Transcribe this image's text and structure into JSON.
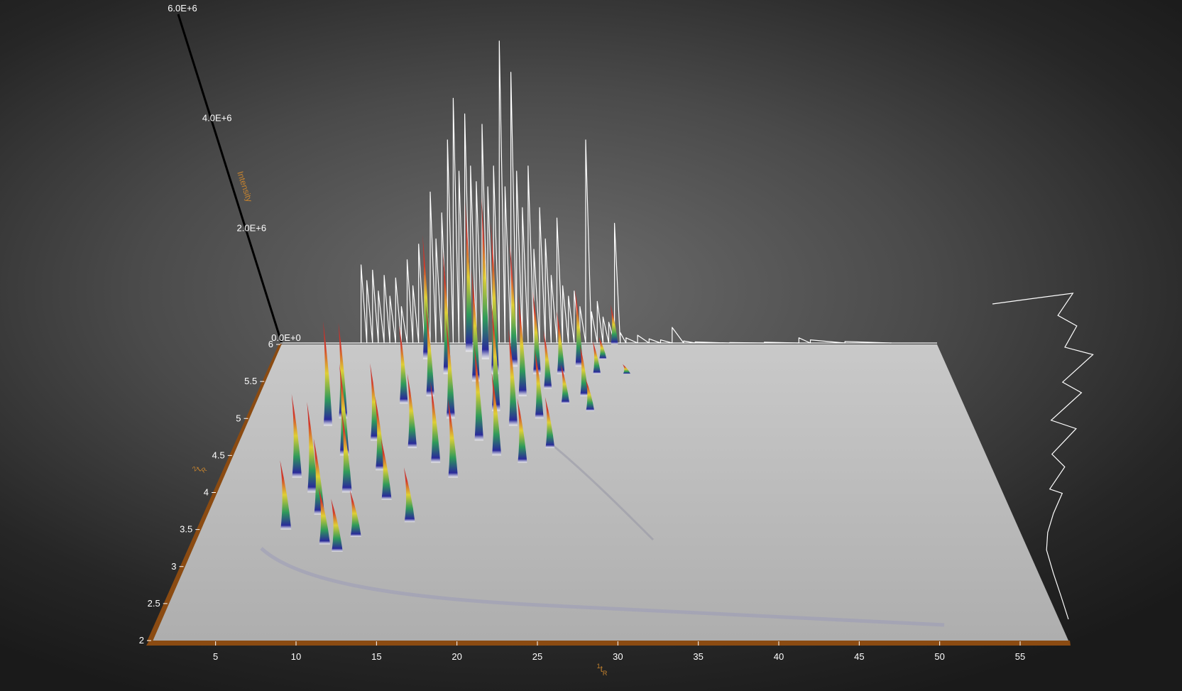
{
  "colors": {
    "floor": "#bdbdbd",
    "axis_bar": "#8b4b12",
    "axis_title": "#c8842e",
    "tick_text": "#ffffff",
    "profile_line": "#ffffff",
    "colormap": [
      "#2a2a9a",
      "#2e9a5a",
      "#dfcf35",
      "#d23a2a"
    ]
  },
  "chart_data": {
    "type": "surface",
    "x_axis": {
      "title": "1tR",
      "title_base": "t",
      "title_sup": "1",
      "title_sub": "R",
      "ticks": [
        "5",
        "10",
        "15",
        "20",
        "25",
        "30",
        "35",
        "40",
        "45",
        "50",
        "55"
      ],
      "range": [
        1,
        58
      ]
    },
    "y_axis": {
      "title": "2tR",
      "title_base": "t",
      "title_sup": "2",
      "title_sub": "R",
      "ticks": [
        "2",
        "2.5",
        "3",
        "3.5",
        "4",
        "4.5",
        "5",
        "5.5",
        "6"
      ],
      "range": [
        2,
        6
      ]
    },
    "z_axis": {
      "title": "Intensity",
      "ticks": [
        "0.0E+0",
        "2.0E+6",
        "4.0E+6",
        "6.0E+6"
      ],
      "range": [
        0,
        6000000
      ]
    },
    "peaks": [
      {
        "x": 6.5,
        "y": 4.2,
        "z": 2000000
      },
      {
        "x": 7.0,
        "y": 3.5,
        "z": 1500000
      },
      {
        "x": 7.5,
        "y": 4.9,
        "z": 2800000
      },
      {
        "x": 8.0,
        "y": 4.0,
        "z": 2100000
      },
      {
        "x": 8.5,
        "y": 5.0,
        "z": 2600000
      },
      {
        "x": 9.0,
        "y": 3.7,
        "z": 1700000
      },
      {
        "x": 9.5,
        "y": 4.5,
        "z": 2300000
      },
      {
        "x": 10.0,
        "y": 3.3,
        "z": 1200000
      },
      {
        "x": 10.5,
        "y": 4.0,
        "z": 1900000
      },
      {
        "x": 11.0,
        "y": 3.2,
        "z": 1100000
      },
      {
        "x": 11.5,
        "y": 4.7,
        "z": 2000000
      },
      {
        "x": 12.0,
        "y": 3.4,
        "z": 1000000
      },
      {
        "x": 12.5,
        "y": 4.3,
        "z": 1800000
      },
      {
        "x": 13.0,
        "y": 5.2,
        "z": 2200000
      },
      {
        "x": 13.5,
        "y": 3.9,
        "z": 1400000
      },
      {
        "x": 14.0,
        "y": 5.8,
        "z": 3900000
      },
      {
        "x": 14.5,
        "y": 4.6,
        "z": 1900000
      },
      {
        "x": 15.0,
        "y": 5.3,
        "z": 2600000
      },
      {
        "x": 15.5,
        "y": 3.6,
        "z": 1200000
      },
      {
        "x": 16.0,
        "y": 5.6,
        "z": 3700000
      },
      {
        "x": 16.5,
        "y": 4.4,
        "z": 2000000
      },
      {
        "x": 17.0,
        "y": 5.0,
        "z": 2700000
      },
      {
        "x": 17.5,
        "y": 5.9,
        "z": 4800000
      },
      {
        "x": 18.0,
        "y": 4.2,
        "z": 1900000
      },
      {
        "x": 18.5,
        "y": 5.5,
        "z": 3300000
      },
      {
        "x": 19.0,
        "y": 5.8,
        "z": 5100000
      },
      {
        "x": 19.5,
        "y": 4.7,
        "z": 2500000
      },
      {
        "x": 20.0,
        "y": 5.6,
        "z": 4600000
      },
      {
        "x": 20.5,
        "y": 5.1,
        "z": 3000000
      },
      {
        "x": 21.0,
        "y": 4.5,
        "z": 2100000
      },
      {
        "x": 21.5,
        "y": 5.7,
        "z": 3800000
      },
      {
        "x": 22.0,
        "y": 4.9,
        "z": 2600000
      },
      {
        "x": 22.5,
        "y": 5.3,
        "z": 2900000
      },
      {
        "x": 23.0,
        "y": 4.4,
        "z": 1600000
      },
      {
        "x": 23.5,
        "y": 5.6,
        "z": 2500000
      },
      {
        "x": 24.0,
        "y": 5.0,
        "z": 1900000
      },
      {
        "x": 24.5,
        "y": 5.4,
        "z": 1700000
      },
      {
        "x": 25.0,
        "y": 4.6,
        "z": 1300000
      },
      {
        "x": 25.5,
        "y": 5.6,
        "z": 1900000
      },
      {
        "x": 26.0,
        "y": 5.2,
        "z": 1100000
      },
      {
        "x": 27.0,
        "y": 5.7,
        "z": 2400000
      },
      {
        "x": 27.5,
        "y": 5.3,
        "z": 1500000
      },
      {
        "x": 28.0,
        "y": 5.1,
        "z": 900000
      },
      {
        "x": 28.5,
        "y": 5.6,
        "z": 1000000
      },
      {
        "x": 29.0,
        "y": 5.8,
        "z": 700000
      },
      {
        "x": 30.0,
        "y": 6.0,
        "z": 1300000
      },
      {
        "x": 31.0,
        "y": 5.6,
        "z": 300000
      }
    ],
    "x_profile": [
      {
        "x": 8.0,
        "z": 1500000
      },
      {
        "x": 8.5,
        "z": 1200000
      },
      {
        "x": 9.0,
        "z": 1400000
      },
      {
        "x": 9.5,
        "z": 1000000
      },
      {
        "x": 10.0,
        "z": 1300000
      },
      {
        "x": 10.5,
        "z": 900000
      },
      {
        "x": 11.0,
        "z": 1250000
      },
      {
        "x": 11.5,
        "z": 700000
      },
      {
        "x": 12.0,
        "z": 1600000
      },
      {
        "x": 12.5,
        "z": 1100000
      },
      {
        "x": 13.0,
        "z": 1900000
      },
      {
        "x": 13.5,
        "z": 1300000
      },
      {
        "x": 14.0,
        "z": 2900000
      },
      {
        "x": 14.5,
        "z": 2000000
      },
      {
        "x": 15.0,
        "z": 2500000
      },
      {
        "x": 15.5,
        "z": 3900000
      },
      {
        "x": 16.0,
        "z": 4700000
      },
      {
        "x": 16.5,
        "z": 3300000
      },
      {
        "x": 17.0,
        "z": 4400000
      },
      {
        "x": 17.5,
        "z": 3400000
      },
      {
        "x": 18.0,
        "z": 3100000
      },
      {
        "x": 18.5,
        "z": 4200000
      },
      {
        "x": 19.0,
        "z": 3000000
      },
      {
        "x": 19.5,
        "z": 3400000
      },
      {
        "x": 20.0,
        "z": 5800000
      },
      {
        "x": 20.5,
        "z": 3000000
      },
      {
        "x": 21.0,
        "z": 5200000
      },
      {
        "x": 21.5,
        "z": 3300000
      },
      {
        "x": 22.0,
        "z": 2600000
      },
      {
        "x": 22.5,
        "z": 3400000
      },
      {
        "x": 23.0,
        "z": 1800000
      },
      {
        "x": 23.5,
        "z": 2600000
      },
      {
        "x": 24.0,
        "z": 2000000
      },
      {
        "x": 24.5,
        "z": 1300000
      },
      {
        "x": 25.0,
        "z": 2400000
      },
      {
        "x": 25.5,
        "z": 1100000
      },
      {
        "x": 26.0,
        "z": 900000
      },
      {
        "x": 26.5,
        "z": 1000000
      },
      {
        "x": 27.0,
        "z": 700000
      },
      {
        "x": 27.5,
        "z": 3900000
      },
      {
        "x": 28.0,
        "z": 600000
      },
      {
        "x": 28.5,
        "z": 800000
      },
      {
        "x": 29.0,
        "z": 500000
      },
      {
        "x": 29.5,
        "z": 400000
      },
      {
        "x": 30.0,
        "z": 2300000
      },
      {
        "x": 30.5,
        "z": 200000
      },
      {
        "x": 31.0,
        "z": 100000
      },
      {
        "x": 32.0,
        "z": 150000
      },
      {
        "x": 33.0,
        "z": 80000
      },
      {
        "x": 34.0,
        "z": 60000
      },
      {
        "x": 35.0,
        "z": 300000
      },
      {
        "x": 36.0,
        "z": 40000
      },
      {
        "x": 37.0,
        "z": 20000
      },
      {
        "x": 40.0,
        "z": 10000
      },
      {
        "x": 43.0,
        "z": 15000
      },
      {
        "x": 46.0,
        "z": 100000
      },
      {
        "x": 47.0,
        "z": 60000
      },
      {
        "x": 50.0,
        "z": 30000
      },
      {
        "x": 54.0,
        "z": 10000
      }
    ],
    "y_profile": [
      {
        "y": 2.0,
        "z": 0
      },
      {
        "y": 2.3,
        "z": 80000
      },
      {
        "y": 2.6,
        "z": 150000
      },
      {
        "y": 2.9,
        "z": 250000
      },
      {
        "y": 3.1,
        "z": 500000
      },
      {
        "y": 3.3,
        "z": 900000
      },
      {
        "y": 3.5,
        "z": 1400000
      },
      {
        "y": 3.6,
        "z": 1100000
      },
      {
        "y": 3.8,
        "z": 1800000
      },
      {
        "y": 4.0,
        "z": 1600000
      },
      {
        "y": 4.2,
        "z": 2600000
      },
      {
        "y": 4.4,
        "z": 2000000
      },
      {
        "y": 4.6,
        "z": 3200000
      },
      {
        "y": 4.8,
        "z": 2800000
      },
      {
        "y": 5.0,
        "z": 4000000
      },
      {
        "y": 5.2,
        "z": 3300000
      },
      {
        "y": 5.4,
        "z": 3900000
      },
      {
        "y": 5.6,
        "z": 3500000
      },
      {
        "y": 5.8,
        "z": 4200000
      },
      {
        "y": 5.9,
        "z": 3000000
      },
      {
        "y": 6.0,
        "z": 1800000
      }
    ]
  }
}
